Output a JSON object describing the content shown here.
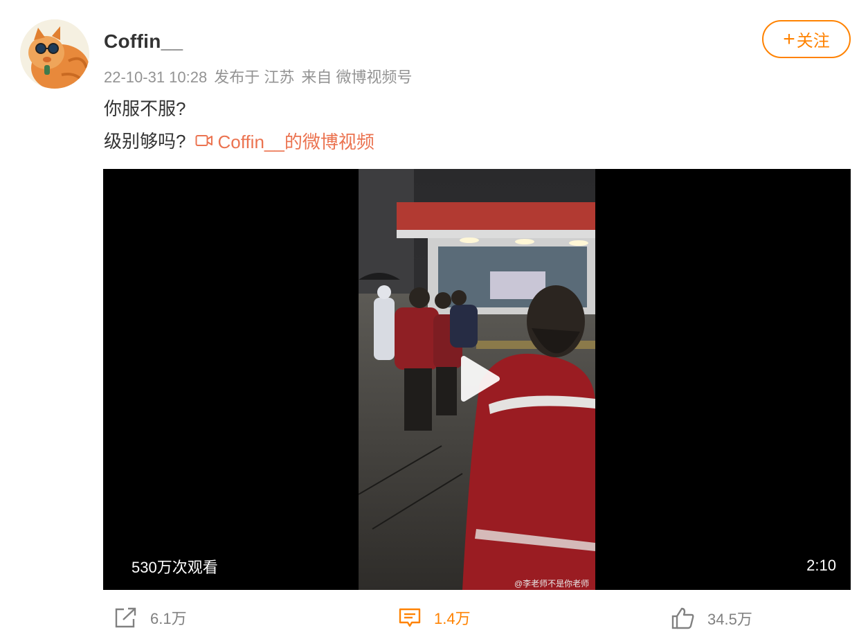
{
  "post": {
    "username": "Coffin__",
    "date": "22-10-31 10:28",
    "location": "发布于 江苏",
    "source": "来自 微博视频号",
    "follow_label": "关注",
    "follow_plus": "+",
    "text_line1": "你服不服?",
    "text_line2": "级别够吗?",
    "video_link": "Coffin__的微博视频"
  },
  "video": {
    "views": "530万次观看",
    "duration": "2:10",
    "watermark": "@李老师不是你老师"
  },
  "actions": {
    "share_count": "6.1万",
    "comment_count": "1.4万",
    "like_count": "34.5万"
  },
  "colors": {
    "accent": "#ff8200",
    "link": "#eb7350",
    "meta": "#939393"
  },
  "icons": {
    "share": "share-icon",
    "comment": "comment-icon",
    "like": "like-icon",
    "play": "play-icon",
    "video_link": "video-camera-icon"
  }
}
